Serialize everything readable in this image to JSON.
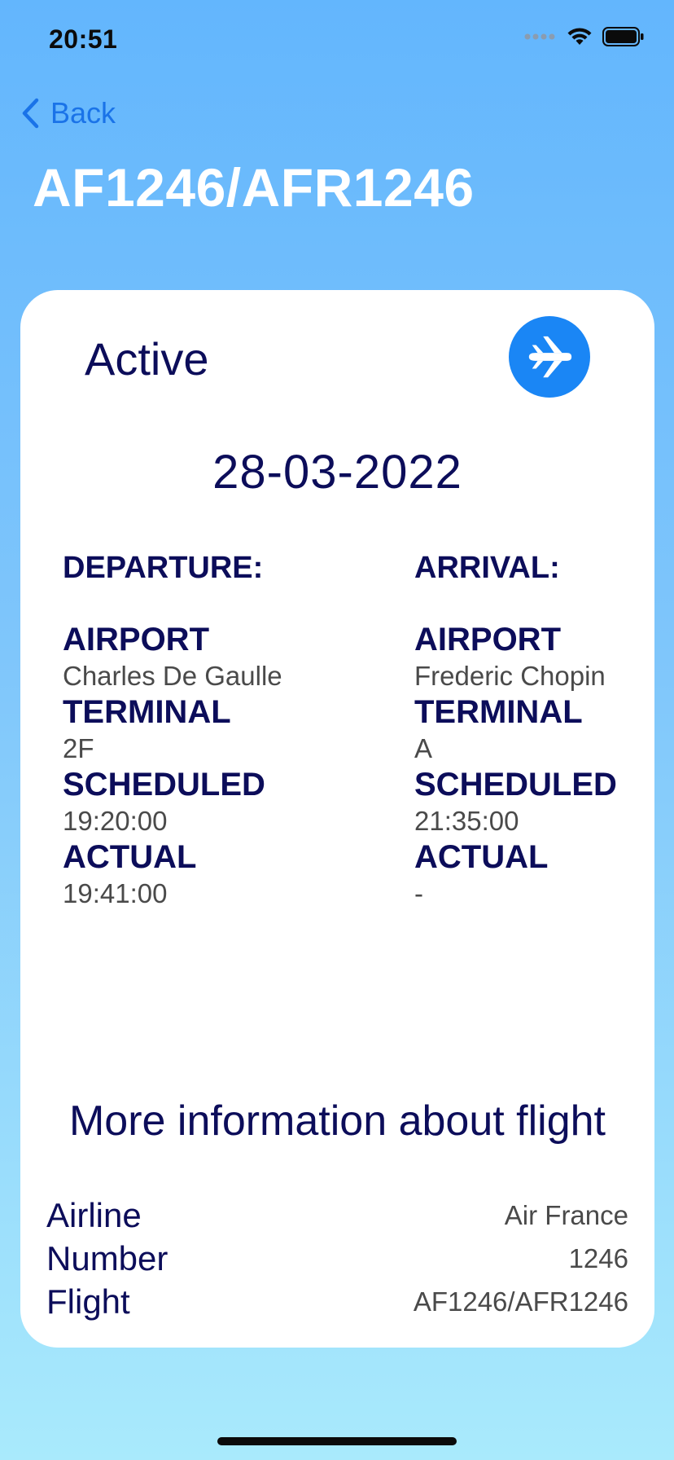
{
  "status_bar": {
    "time": "20:51"
  },
  "nav": {
    "back_label": "Back"
  },
  "header": {
    "title": "AF1246/AFR1246"
  },
  "flight": {
    "status": "Active",
    "date": "28-03-2022",
    "departure": {
      "heading": "DEPARTURE:",
      "airport_label": "AIRPORT",
      "airport": "Charles De Gaulle",
      "terminal_label": "TERMINAL",
      "terminal": "2F",
      "scheduled_label": "SCHEDULED",
      "scheduled": "19:20:00",
      "actual_label": "ACTUAL",
      "actual": "19:41:00"
    },
    "arrival": {
      "heading": "ARRIVAL:",
      "airport_label": "AIRPORT",
      "airport": "Frederic Chopin",
      "terminal_label": "TERMINAL",
      "terminal": "A",
      "scheduled_label": "SCHEDULED",
      "scheduled": "21:35:00",
      "actual_label": "ACTUAL",
      "actual": "-"
    }
  },
  "more_info": {
    "title": "More information about flight",
    "rows": [
      {
        "key": "Airline",
        "value": "Air France"
      },
      {
        "key": "Number",
        "value": "1246"
      },
      {
        "key": "Flight",
        "value": "AF1246/AFR1246"
      }
    ]
  },
  "icons": {
    "back": "chevron-left-icon",
    "status": "airplane-icon",
    "signal": "cellular-signal-icon",
    "wifi": "wifi-icon",
    "battery": "battery-icon"
  },
  "colors": {
    "accent": "#1a86f5",
    "title_text": "#0c0d5a",
    "background_top": "#63b6fd",
    "background_bottom": "#a9eafc"
  }
}
